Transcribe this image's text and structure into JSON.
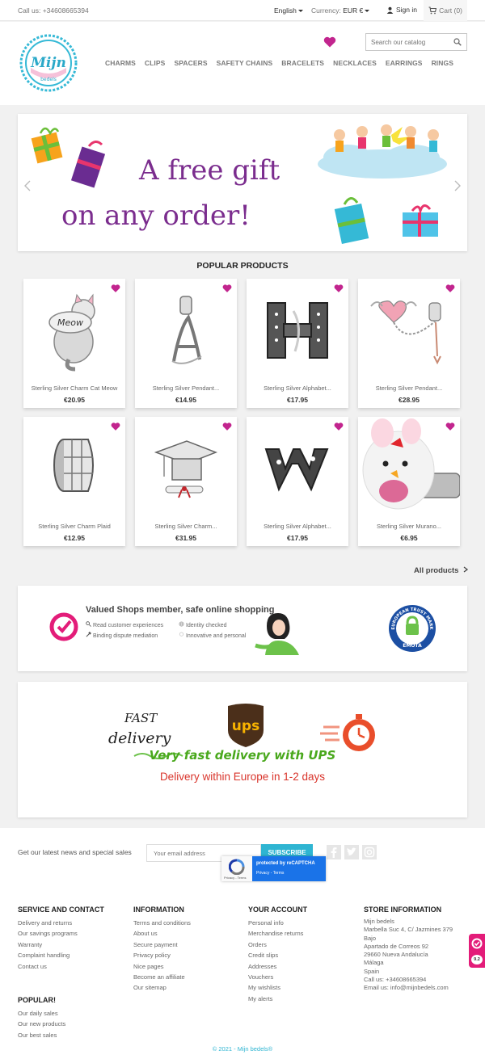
{
  "topbar": {
    "call": "Call us: +34608665394",
    "language": "English",
    "currency_label": "Currency:",
    "currency_value": "EUR €",
    "signin": "Sign in",
    "cart": "Cart (0)"
  },
  "header": {
    "logo_text": "Mijn",
    "logo_sub": "bedels",
    "search_placeholder": "Search our catalog",
    "menu": [
      "CHARMS",
      "CLIPS",
      "SPACERS",
      "SAFETY CHAINS",
      "BRACELETS",
      "NECKLACES",
      "EARRINGS",
      "RINGS"
    ]
  },
  "slider": {
    "line1": "A free gift",
    "line2": "on any order!"
  },
  "popular": {
    "title": "POPULAR PRODUCTS",
    "products": [
      {
        "name": "Sterling Silver Charm Cat Meow",
        "price": "€20.95"
      },
      {
        "name": "Sterling Silver Pendant...",
        "price": "€14.95"
      },
      {
        "name": "Sterling Silver Alphabet...",
        "price": "€17.95"
      },
      {
        "name": "Sterling Silver Pendant...",
        "price": "€28.95"
      },
      {
        "name": "Sterling Silver Charm Plaid",
        "price": "€12.95"
      },
      {
        "name": "Sterling Silver Charm...",
        "price": "€31.95"
      },
      {
        "name": "Sterling Silver Alphabet...",
        "price": "€17.95"
      },
      {
        "name": "Sterling Silver Murano...",
        "price": "€6.95"
      }
    ],
    "all_products": "All products",
    "meow_text": "Meow"
  },
  "valued_shops": {
    "title": "Valued Shops member, safe online shopping",
    "items": [
      "Read customer  experiences",
      "Identity checked",
      "Binding dispute mediation",
      "Innovative and personal"
    ],
    "trust_mark_top": "EUROPEAN TRUST MARK",
    "trust_mark_bottom": "EMOTA"
  },
  "delivery": {
    "fast": "FAST",
    "delivery_word": "delivery",
    "ups": "ups",
    "line1": "Very fast delivery with UPS",
    "line2": "Delivery within Europe in 1-2 days"
  },
  "newsletter": {
    "text": "Get our latest news and special sales",
    "placeholder": "Your email address",
    "button": "SUBSCRIBE",
    "recaptcha": "protected by reCAPTCHA",
    "recaptcha_links": "Privacy - Terms",
    "recaptcha_small": "Privacy - Terms"
  },
  "footer": {
    "service": {
      "title": "SERVICE AND CONTACT",
      "items": [
        "Delivery and returns",
        "Our savings programs",
        "Warranty",
        "Complaint handling",
        "Contact us"
      ]
    },
    "popular": {
      "title": "POPULAR!",
      "items": [
        "Our daily sales",
        "Our new products",
        "Our best sales"
      ]
    },
    "information": {
      "title": "INFORMATION",
      "items": [
        "Terms and conditions",
        "About us",
        "Secure payment",
        "Privacy policy",
        "Nice pages",
        "Become an affiliate",
        "Our sitemap"
      ]
    },
    "account": {
      "title": "YOUR ACCOUNT",
      "items": [
        "Personal info",
        "Merchandise returns",
        "Orders",
        "Credit slips",
        "Addresses",
        "Vouchers",
        "My wishlists",
        "My alerts"
      ]
    },
    "store": {
      "title": "STORE INFORMATION",
      "items": [
        "Mijn bedels",
        "Marbella Suc 4, C/ Jazmines 379",
        "Bajo",
        "Apartado de Correos 92",
        "29660 Nueva Andalucía",
        "Málaga",
        "Spain",
        "Call us: +34608665394",
        "Email us: info@mijnbedels.com"
      ]
    },
    "copyright": "© 2021 - Mijn bedels®"
  },
  "side_badge": "9.2",
  "colors": {
    "accent": "#2fb5d2",
    "heart": "#c2258e",
    "slider_text": "#7b2d8e",
    "delivery_green": "#49a81c",
    "delivery_red": "#d9342b"
  }
}
